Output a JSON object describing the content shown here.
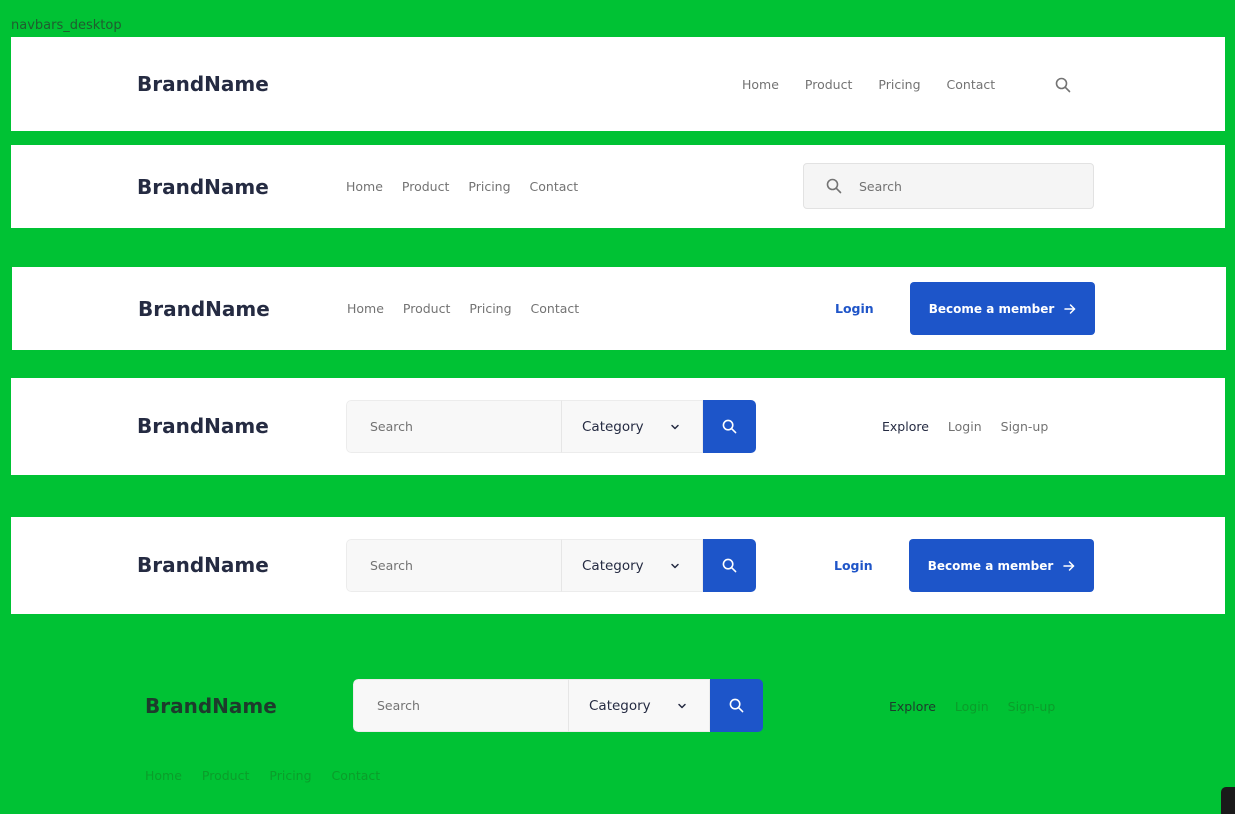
{
  "frame": {
    "label": "navbars_desktop"
  },
  "brand": "BrandName",
  "nav_links": [
    "Home",
    "Product",
    "Pricing",
    "Contact"
  ],
  "search": {
    "placeholder": "Search",
    "category_label": "Category"
  },
  "auth": {
    "login": "Login",
    "become_member": "Become a member",
    "explore": "Explore",
    "signup": "Sign-up"
  },
  "icons": {
    "search": "search-icon",
    "chevron": "chevron-down-icon",
    "arrow": "arrow-right-icon"
  },
  "colors": {
    "background": "#00c234",
    "primary": "#1d55c9",
    "heading": "#252b42",
    "muted_text": "#737373"
  }
}
